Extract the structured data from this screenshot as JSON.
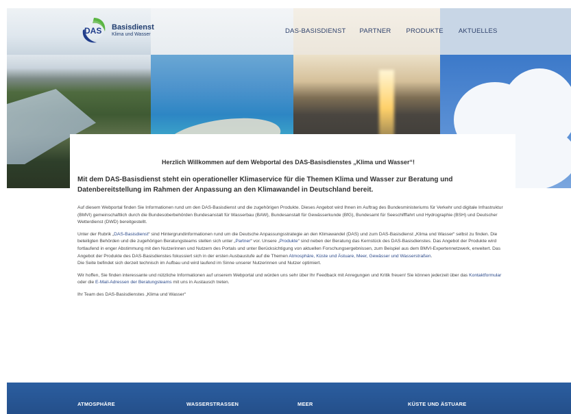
{
  "logo": {
    "title": "Basisdienst",
    "subtitle": "Klima und Wasser",
    "mark_text": "DAS"
  },
  "nav": [
    {
      "label": "DAS-BASISDIENST"
    },
    {
      "label": "PARTNER"
    },
    {
      "label": "PRODUKTE"
    },
    {
      "label": "AKTUELLES"
    }
  ],
  "content": {
    "welcome": "Herzlich Willkommen auf dem Webportal des DAS-Basisdienstes „Klima und Wasser“!",
    "lead": "Mit dem DAS-Basisdienst steht ein operationeller Klimaservice für die Themen Klima und Wasser zur Beratung und Datenbereitstellung im Rahmen der Anpassung an den Klimawandel in Deutschland bereit.",
    "p1": "Auf diesem Webportal finden Sie Informationen rund um den DAS-Basisdienst und die zugehörigen Produkte. Dieses Angebot wird Ihnen im Auftrag des Bundesministeriums für Verkehr und digitale Infrastruktur (BMVI) gemeinschaftlich durch die Bundesoberbehörden Bundesanstalt für Wasserbau (BAW), Bundesanstalt für Gewässerkunde (BfG), Bundesamt für Seeschifffahrt und Hydrographie (BSH) und Deutscher Wetterdienst (DWD) bereitgestellt.",
    "p2a": "Unter der Rubrik „",
    "p2_link1": "DAS-Basisdienst",
    "p2b": "“ sind Hintergrundinformationen rund um die Deutsche Anpassungsstrategie an den Klimawandel (DAS) und zum DAS-Basisdienst „Klima und Wasser“ selbst zu finden. Die beteiligten Behörden und die zugehörigen Beratungsteams stellen sich unter „",
    "p2_link2": "Partner",
    "p2c": "“ vor. Unsere „",
    "p2_link3": "Produkte",
    "p2d": "“ sind neben der Beratung das Kernstück des DAS-Basisdienstes. Das Angebot der Produkte wird fortlaufend in enger Abstimmung mit den Nutzerinnen und Nutzern des Portals und unter Berücksichtigung von aktuellen Forschungsergebnissen, zum Beispiel aus dem BMVI-Expertennetzwerk, erweitert. Das Angebot der Produkte des DAS-Basisdienstes fokussiert sich in der ersten Ausbaustufe auf die Themen ",
    "p2_link4": "Atmosphäre, Küste und Ästuare, Meer, Gewässer und Wasserstraßen",
    "p2e": ".",
    "p2f": "Die Seite befindet sich derzeit technisch im Aufbau und wird laufend im Sinne unserer Nutzerinnen und Nutzer optimiert.",
    "p3a": "Wir hoffen, Sie finden interessante und nützliche Informationen auf unserem Webportal und würden uns sehr über Ihr Feedback mit Anregungen und Kritik freuen! Sie können jederzeit über das ",
    "p3_link1": "Kontaktformular",
    "p3b": " oder die ",
    "p3_link2": "E-Mail-Adressen der Beratungsteams",
    "p3c": " mit uns in Austausch treten.",
    "p4": "Ihr Team des DAS-Basisdienstes „Klima und Wasser“"
  },
  "footer": [
    {
      "label": "ATMOSPHÄRE"
    },
    {
      "label": "WASSERSTRASSEN"
    },
    {
      "label": "MEER"
    },
    {
      "label": "KÜSTE UND ÄSTUARE"
    }
  ],
  "colors": {
    "brand_blue": "#2b5ea0",
    "nav_text": "#2c3f6a",
    "link": "#2c4a8a",
    "logo_green": "#5bb543",
    "logo_blue": "#1f3c8a"
  }
}
